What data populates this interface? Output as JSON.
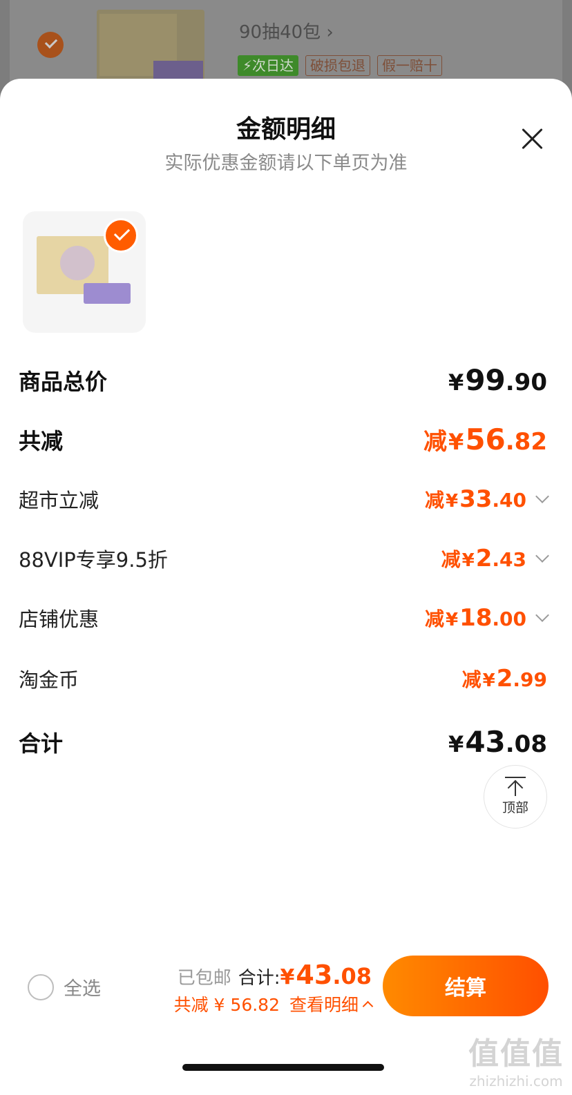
{
  "background_item": {
    "title": "90抽40包",
    "tags": [
      "次日达",
      "破损包退",
      "假一赔十"
    ]
  },
  "sheet": {
    "title": "金额明细",
    "subtitle": "实际优惠金额请以下单页为准"
  },
  "rows": {
    "subtotal": {
      "label": "商品总价",
      "prefix": "",
      "yen": "¥",
      "int": "99",
      "dec": ".90"
    },
    "total_discount": {
      "label": "共减",
      "prefix": "减",
      "yen": "¥",
      "int": "56",
      "dec": ".82"
    },
    "discounts": [
      {
        "label": "超市立减",
        "prefix": "减",
        "yen": "¥",
        "int": "33",
        "dec": ".40",
        "expandable": true
      },
      {
        "label": "88VIP专享9.5折",
        "prefix": "减",
        "yen": "¥",
        "int": "2",
        "dec": ".43",
        "expandable": true
      },
      {
        "label": "店铺优惠",
        "prefix": "减",
        "yen": "¥",
        "int": "18",
        "dec": ".00",
        "expandable": true
      },
      {
        "label": "淘金币",
        "prefix": "减",
        "yen": "¥",
        "int": "2",
        "dec": ".99",
        "expandable": false
      }
    ],
    "total": {
      "label": "合计",
      "prefix": "",
      "yen": "¥",
      "int": "43",
      "dec": ".08"
    }
  },
  "back_to_top": {
    "label": "顶部"
  },
  "footer": {
    "select_all": "全选",
    "shipping": "已包邮",
    "total_label": "合计:",
    "total_yen": "¥",
    "total_int": "43",
    "total_dec": ".08",
    "saved": "共减 ¥ 56.82",
    "details_link": "查看明细",
    "checkout": "结算"
  },
  "watermark": {
    "big": "值值值",
    "small": "zhizhizhi.com"
  },
  "colors": {
    "accent": "#ff5000",
    "checkout_gradient_start": "#ff8a00",
    "checkout_gradient_end": "#ff4f00"
  }
}
